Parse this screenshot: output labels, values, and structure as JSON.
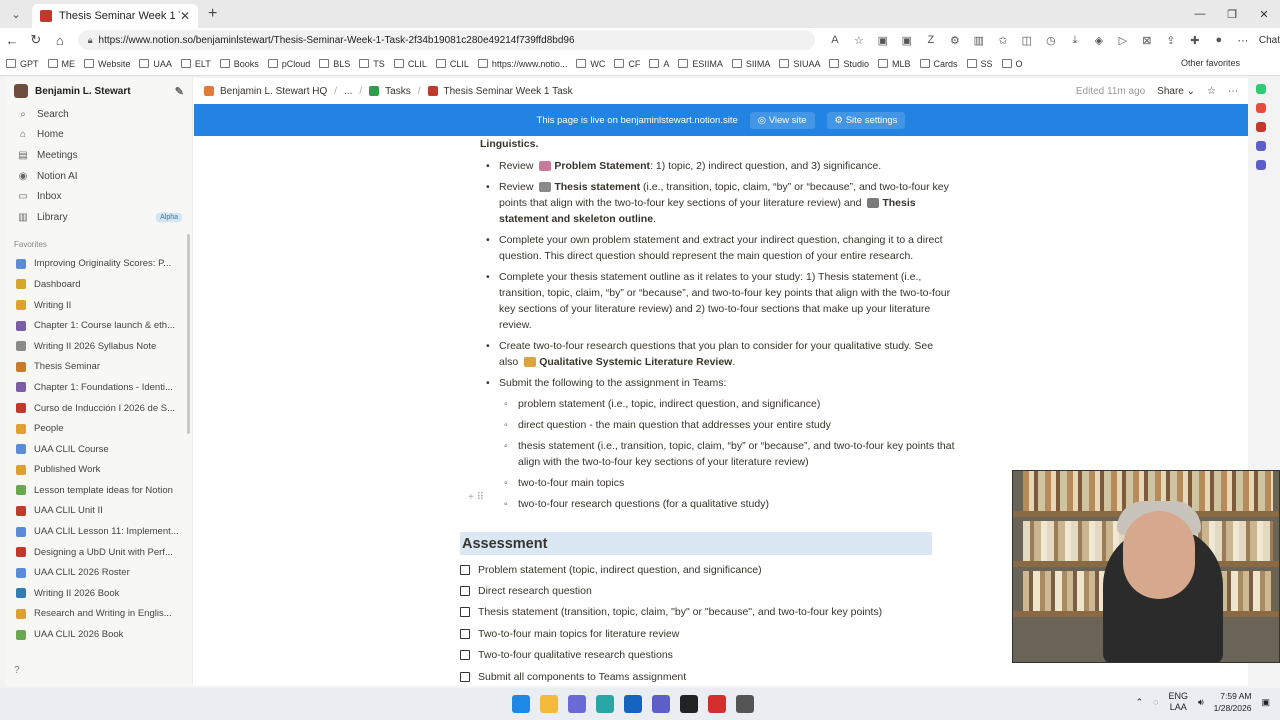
{
  "browser": {
    "tab_title": "Thesis Seminar Week 1 Task",
    "url": "https://www.notion.so/benjaminlstewart/Thesis-Seminar-Week-1-Task-2f34b19081c280e49214f739ffd8bd96",
    "chat_label": "Chat",
    "bookmarks": [
      "GPT",
      "ME",
      "Website",
      "UAA",
      "ELT",
      "Books",
      "pCloud",
      "BLS",
      "TS",
      "CLIL",
      "CLIL",
      "https://www.notio...",
      "WC",
      "CF",
      "A",
      "ESIIMA",
      "SIIMA",
      "SIUAA",
      "Studio",
      "MLB",
      "Cards",
      "SS",
      "O"
    ],
    "other_favorites": "Other favorites"
  },
  "sidebar": {
    "workspace": "Benjamin L. Stewart",
    "nav": [
      {
        "label": "Search",
        "icon": "search-icon"
      },
      {
        "label": "Home",
        "icon": "home-icon"
      },
      {
        "label": "Meetings",
        "icon": "meetings-icon"
      },
      {
        "label": "Notion AI",
        "icon": "ai-icon"
      },
      {
        "label": "Inbox",
        "icon": "inbox-icon"
      },
      {
        "label": "Library",
        "icon": "library-icon"
      }
    ],
    "alpha_badge": "Alpha",
    "favorites_heading": "Favorites",
    "favorites": [
      {
        "label": "Improving Originality Scores: P...",
        "color": "#5b8dd6"
      },
      {
        "label": "Dashboard",
        "color": "#d4a72c"
      },
      {
        "label": "Writing II",
        "color": "#e0a030"
      },
      {
        "label": "Chapter 1: Course launch & eth...",
        "color": "#7b5ea7"
      },
      {
        "label": "Writing II 2026 Syllabus Note",
        "color": "#8a8a8a"
      },
      {
        "label": "Thesis Seminar",
        "color": "#c97a2a"
      },
      {
        "label": "Chapter 1: Foundations - Identi...",
        "color": "#7b5ea7"
      },
      {
        "label": "Curso de Inducción I 2026 de S...",
        "color": "#c0392b"
      },
      {
        "label": "People",
        "color": "#e0a030"
      },
      {
        "label": "UAA CLIL Course",
        "color": "#5b8dd6"
      },
      {
        "label": "Published Work",
        "color": "#e0a030"
      },
      {
        "label": "Lesson template ideas for Notion",
        "color": "#6aa84f"
      },
      {
        "label": "UAA CLIL Unit II",
        "color": "#c0392b"
      },
      {
        "label": "UAA CLIL Lesson 11: Implement...",
        "color": "#5b8dd6"
      },
      {
        "label": "Designing a UbD Unit with Perf...",
        "color": "#c0392b"
      },
      {
        "label": "UAA CLIL 2026 Roster",
        "color": "#5b8dd6"
      },
      {
        "label": "Writing II 2026 Book",
        "color": "#2f7db4"
      },
      {
        "label": "Research and Writing in Englis...",
        "color": "#e0a030"
      },
      {
        "label": "UAA CLIL 2026 Book",
        "color": "#6aa84f"
      }
    ]
  },
  "topbar": {
    "crumbs": [
      "Benjamin L. Stewart HQ",
      "...",
      "Tasks",
      "Thesis Seminar Week 1 Task"
    ],
    "edited": "Edited 11m ago",
    "share": "Share"
  },
  "banner": {
    "text": "This page is live on benjaminlstewart.notion.site",
    "view_site": "View site",
    "site_settings": "Site settings"
  },
  "doc": {
    "top_fragment": "Linguistics",
    "bullets": [
      {
        "pre": "Review ",
        "bold": "Problem Statement",
        "post": ": 1) topic, 2) indirect question, and 3) significance."
      },
      {
        "pre": "Review ",
        "bold": "Thesis statement",
        "post": " (i.e., transition, topic, claim, “by” or “because”, and two-to-four key points that align with the two-to-four key sections of your literature review) and ",
        "bold2": "Thesis statement and skeleton outline",
        "post2": "."
      },
      {
        "pre": "Complete your own problem statement and extract your indirect question, changing it to a direct question. This direct question should represent the main question of your entire research."
      },
      {
        "pre": "Complete your thesis statement outline as it relates to your study: 1) Thesis statement (i.e., transition, topic, claim, “by” or “because”, and two-to-four key points that align with the two-to-four key sections of your literature review) and 2) two-to-four sections that make up your literature review."
      },
      {
        "pre": "Create two-to-four research questions that you plan to consider for your qualitative study. See also ",
        "bold": "Qualitative Systemic Literature Review",
        "post": "."
      },
      {
        "pre": "Submit the following to the assignment in Teams:"
      }
    ],
    "sub_bullets": [
      "problem statement (i.e., topic, indirect question, and significance)",
      "direct question - the main question that addresses your entire study",
      "thesis statement (i.e., transition, topic, claim, “by” or “because”, and two-to-four key points that align with the two-to-four key sections of your literature review)",
      "two-to-four main topics",
      "two-to-four research questions (for a qualitative study)"
    ],
    "heading": "Assessment",
    "checklist": [
      "Problem statement (topic, indirect question, and significance)",
      "Direct research question",
      "Thesis statement (transition, topic, claim, \"by\" or \"because\", and two-to-four key points)",
      "Two-to-four main topics for literature review",
      "Two-to-four qualitative research questions",
      "Submit all components to Teams assignment"
    ]
  },
  "taskbar": {
    "lang_top": "ENG",
    "lang_bottom": "LAA",
    "time": "7:59 AM",
    "date": "1/28/2026"
  }
}
